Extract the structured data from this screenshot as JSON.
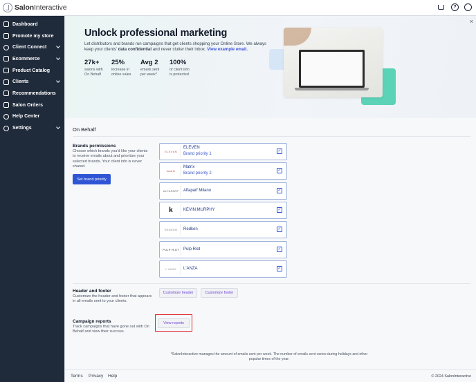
{
  "app": {
    "logo_bold": "Salon",
    "logo_light": "Interactive"
  },
  "topbar": {
    "icons": [
      "cart-icon",
      "help-icon",
      "user-icon"
    ]
  },
  "sidebar": {
    "items": [
      {
        "label": "Dashboard",
        "icon": "grid-icon",
        "chevron": false
      },
      {
        "label": "Promote my store",
        "icon": "megaphone-icon",
        "chevron": false
      },
      {
        "label": "Client Connect",
        "icon": "connect-icon",
        "chevron": true
      },
      {
        "label": "Ecommerce",
        "icon": "bag-icon",
        "chevron": true
      },
      {
        "label": "Product Catalog",
        "icon": "catalog-icon",
        "chevron": false
      },
      {
        "label": "Clients",
        "icon": "users-icon",
        "chevron": true
      },
      {
        "label": "Recommendations",
        "icon": "heart-icon",
        "chevron": false
      },
      {
        "label": "Salon Orders",
        "icon": "orders-icon",
        "chevron": false
      },
      {
        "label": "Help Center",
        "icon": "help-circle-icon",
        "chevron": false
      },
      {
        "label": "Settings",
        "icon": "gear-icon",
        "chevron": true
      }
    ]
  },
  "hero": {
    "close": "×",
    "title": "Unlock professional marketing",
    "desc_1": "Let distributors and brands run campaigns that get clients shopping your Online Store. We always keep your clients' ",
    "desc_bold": "data confidential",
    "desc_2": " and never clutter their inbox. ",
    "desc_link": "View example email.",
    "stats": [
      {
        "value": "27k+",
        "label_1": "salons with",
        "label_2": "On Behalf"
      },
      {
        "value": "25%",
        "label_1": "increase in",
        "label_2": "online sales"
      },
      {
        "value": "Avg 2",
        "label_1": "emails sent",
        "label_2": "per week*"
      },
      {
        "value": "100%",
        "label_1": "of client info",
        "label_2": "is protected"
      }
    ]
  },
  "section": {
    "title": "On Behalf"
  },
  "brands_permissions": {
    "title": "Brands permissions",
    "description": "Choose which brands you'd like your clients to receive emails about and prioritize your selected brands. Your client info is never shared.",
    "button": "Set brand priority",
    "brands": [
      {
        "name": "ELEVEN",
        "sub": "Brand priority 1",
        "logo": "ELEVEN",
        "logo_color": "#d64b4b",
        "checked": true
      },
      {
        "name": "Matrix",
        "sub": "Brand priority 2",
        "logo": "matrix",
        "logo_color": "#c0392b",
        "checked": true
      },
      {
        "name": "Alfaparf Milano",
        "sub": "",
        "logo": "ALFAPARF",
        "logo_color": "#666666",
        "checked": true
      },
      {
        "name": "KEVIN.MURPHY",
        "sub": "",
        "logo": "k",
        "logo_color": "#111111",
        "checked": true
      },
      {
        "name": "Redken",
        "sub": "",
        "logo": "REDKEN",
        "logo_color": "#888888",
        "checked": true
      },
      {
        "name": "Pulp Riot",
        "sub": "",
        "logo": "PULP RIOT",
        "logo_color": "#333333",
        "checked": true
      },
      {
        "name": "L'ANZA",
        "sub": "",
        "logo": "L'ANZA",
        "logo_color": "#999999",
        "checked": true
      }
    ]
  },
  "header_footer": {
    "title": "Header and footer",
    "description": "Customize the header and footer that appears in all emails sent to your clients.",
    "customize_header": "Customize header",
    "customize_footer": "Customize footer"
  },
  "campaign_reports": {
    "title": "Campaign reports",
    "description": "Track campaigns that have gone out with On Behalf and view their success.",
    "button": "View reports"
  },
  "footnote": "*SalonInteractive manages the amount of emails sent per week. The number of emails sent varies during holidays and other popular times of the year.",
  "footer": {
    "links": [
      "Terms",
      "Privacy",
      "Help"
    ],
    "copyright": "© 2024 SalonInteractive"
  },
  "colors": {
    "sidebar_bg": "#1f2a3a",
    "primary": "#2f55d4",
    "accent_purple": "#6d43d1",
    "highlight_red": "#e0222b",
    "hero_green": "#5cd2b6"
  }
}
